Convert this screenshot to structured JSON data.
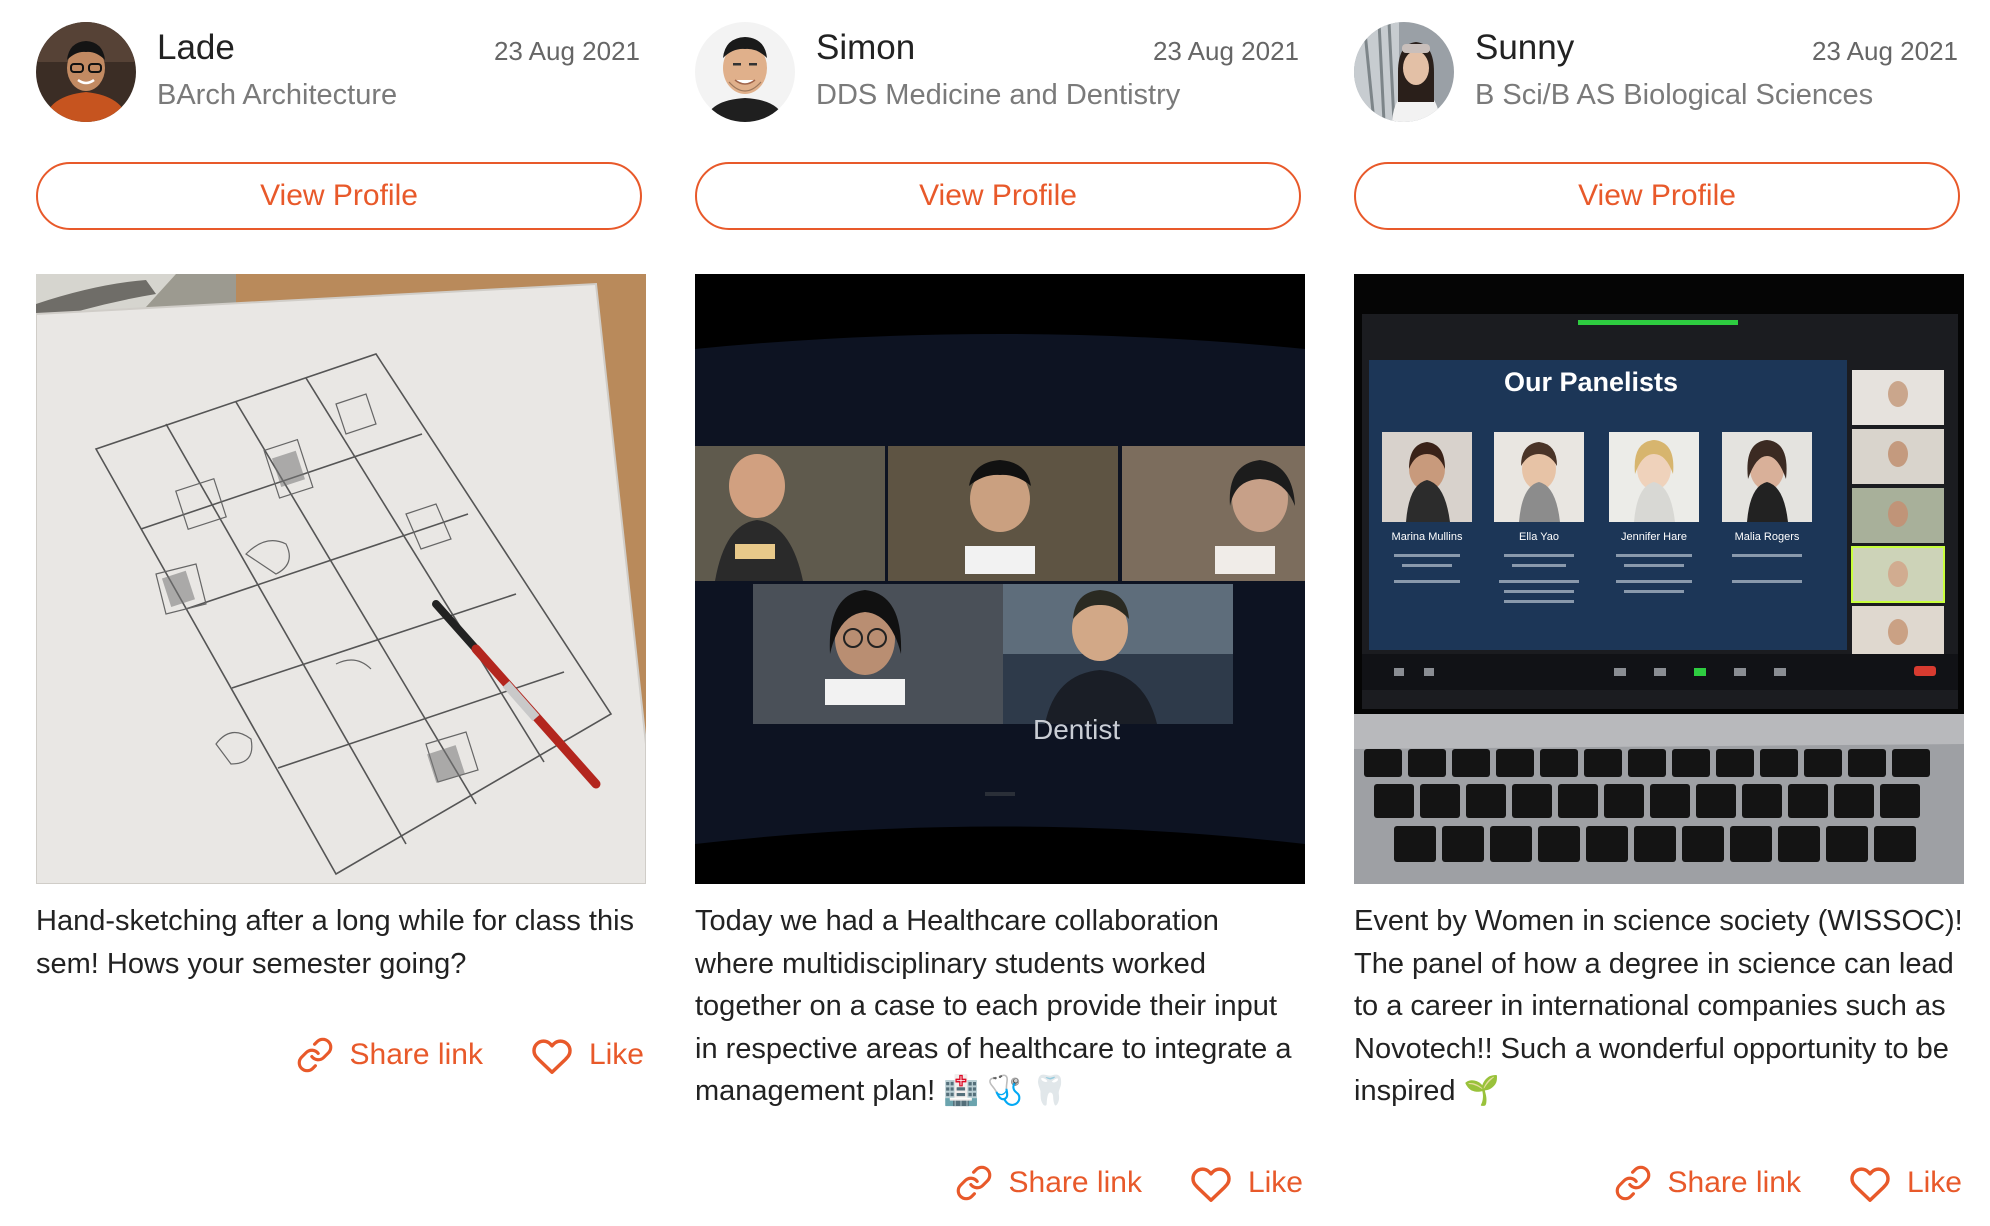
{
  "feed": {
    "cards": [
      {
        "name": "Lade",
        "date": "23 Aug 2021",
        "course": "BArch Architecture",
        "view_profile_label": "View Profile",
        "caption": "Hand-sketching after a long while for class this sem! Hows your semester going?",
        "share_label": "Share link",
        "like_label": "Like",
        "photo_text": ""
      },
      {
        "name": "Simon",
        "date": "23 Aug 2021",
        "course": "DDS Medicine and Dentistry",
        "view_profile_label": "View Profile",
        "caption": "Today we had a Healthcare collaboration where multidisciplinary students worked together on a case to each provide their input in respective areas of healthcare to integrate a management plan! 🏥 🩺 🦷",
        "share_label": "Share link",
        "like_label": "Like",
        "photo_text": "Dentist"
      },
      {
        "name": "Sunny",
        "date": "23 Aug 2021",
        "course": "B Sci/B AS Biological Sciences",
        "view_profile_label": "View Profile",
        "caption": "Event by Women in science society (WISSOC)! The panel of how a degree in science can lead to a career in international companies such as Novotech!! Such a wonderful opportunity to be inspired 🌱",
        "share_label": "Share link",
        "like_label": "Like",
        "photo_text": "Our Panelists",
        "panelists": [
          "Marina Mullins",
          "Ella Yao",
          "Jennifer Hare",
          "Malia Rogers"
        ]
      }
    ]
  },
  "colors": {
    "accent": "#e8592a",
    "text": "#222222",
    "muted": "#7a7a7a"
  },
  "icons": [
    "link-icon",
    "heart-icon"
  ]
}
